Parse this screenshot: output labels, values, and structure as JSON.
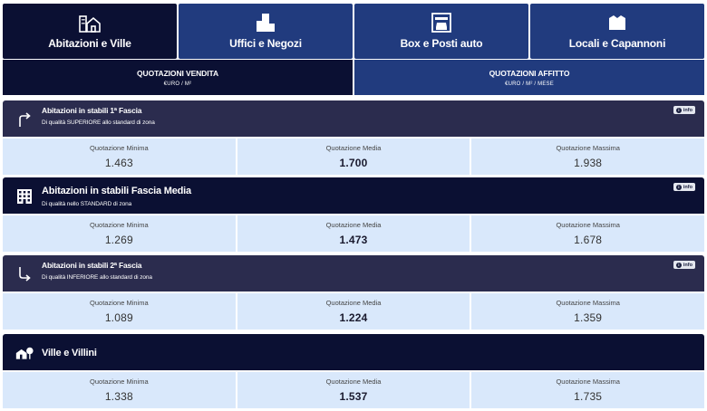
{
  "tabs": [
    {
      "label": "Abitazioni e Ville",
      "icon": "house-buildings-icon",
      "active": true
    },
    {
      "label": "Uffici e Negozi",
      "icon": "office-building-icon",
      "active": false
    },
    {
      "label": "Box e Posti auto",
      "icon": "garage-car-icon",
      "active": false
    },
    {
      "label": "Locali e Capannoni",
      "icon": "warehouse-icon",
      "active": false
    }
  ],
  "subtabs": [
    {
      "title": "QUOTAZIONI VENDITA",
      "unit": "€URO / M²",
      "active": true
    },
    {
      "title": "QUOTAZIONI AFFITTO",
      "unit": "€URO / M² / MESE",
      "active": false
    }
  ],
  "info_label": "info",
  "sections": [
    {
      "title": "Abitazioni in stabili 1ª Fascia",
      "subtitle": "Di qualità SUPERIORE allo standard di zona",
      "icon": "arrow-up-right-icon",
      "min_label": "Quotazione Minima",
      "min": "1.463",
      "avg_label": "Quotazione Media",
      "avg": "1.700",
      "max_label": "Quotazione Massima",
      "max": "1.938"
    },
    {
      "title": "Abitazioni in stabili Fascia Media",
      "subtitle": "Di qualità nello STANDARD di zona",
      "icon": "apartment-building-icon",
      "min_label": "Quotazione Minima",
      "min": "1.269",
      "avg_label": "Quotazione Media",
      "avg": "1.473",
      "max_label": "Quotazione Massima",
      "max": "1.678"
    },
    {
      "title": "Abitazioni in stabili 2ª Fascia",
      "subtitle": "Di qualità INFERIORE allo standard di zona",
      "icon": "arrow-down-right-icon",
      "min_label": "Quotazione Minima",
      "min": "1.089",
      "avg_label": "Quotazione Media",
      "avg": "1.224",
      "max_label": "Quotazione Massima",
      "max": "1.359"
    },
    {
      "title": "Ville e Villini",
      "subtitle": "",
      "icon": "villa-tree-icon",
      "min_label": "Quotazione Minima",
      "min": "1.338",
      "avg_label": "Quotazione Media",
      "avg": "1.537",
      "max_label": "Quotazione Massima",
      "max": "1.735"
    }
  ],
  "colors": {
    "active": "#0b1033",
    "inactive": "#213b7e",
    "value_bg": "#d9e8fb"
  }
}
